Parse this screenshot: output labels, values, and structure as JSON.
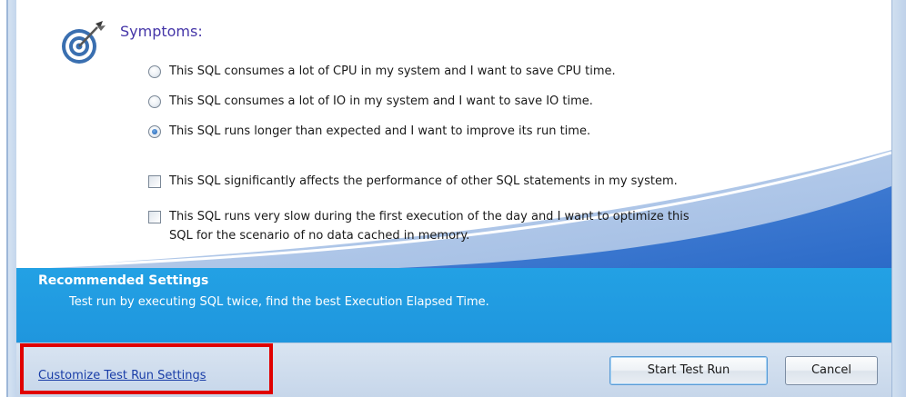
{
  "symptoms": {
    "title": "Symptoms:",
    "icon": "target-icon",
    "radio_options": [
      {
        "label": "This SQL consumes a lot of CPU in my system and I want to save CPU time.",
        "checked": false
      },
      {
        "label": "This SQL consumes a lot of IO in my system and I want to save IO time.",
        "checked": false
      },
      {
        "label": "This SQL runs longer than expected and I want to improve its run time.",
        "checked": true
      }
    ],
    "checkbox_options": [
      {
        "label": "This SQL significantly affects the performance of other SQL statements in my system.",
        "checked": false
      },
      {
        "label_line1": "This SQL runs very slow during the first execution of the day and I want to optimize this",
        "label_line2": "SQL for the scenario of no data cached in memory.",
        "checked": false
      }
    ]
  },
  "recommended": {
    "title": "Recommended Settings",
    "text": "Test run by executing SQL twice, find the best Execution Elapsed Time."
  },
  "footer": {
    "customize_link": "Customize Test Run Settings",
    "start_button": "Start Test Run",
    "cancel_button": "Cancel"
  },
  "colors": {
    "title_purple": "#4536a8",
    "panel_blue": "#23a1e4",
    "highlight_red": "#e00000"
  }
}
